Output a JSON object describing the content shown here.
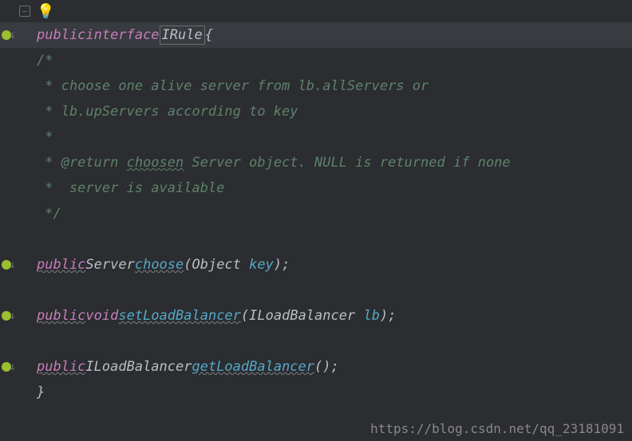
{
  "top": {
    "fold": "−",
    "bulb": "💡"
  },
  "gutter": {
    "marker": "",
    "arrow": "↓"
  },
  "code": {
    "l1": {
      "kw1": "public",
      "kw2": "interface",
      "name": "IRule",
      "brace": "{"
    },
    "c1": "/*",
    "c2": " * choose one alive server from lb.allServers or",
    "c3": " * lb.upServers according to key",
    "c4": " * ",
    "c5a": " * @return ",
    "c5b": "choosen",
    "c5c": " Server object. NULL is returned if none",
    "c6": " *  server is available",
    "c7": " */",
    "m1": {
      "kw": "public",
      "ret": "Server",
      "name": "choose",
      "p1": "(",
      "ptype": "Object ",
      "pname": "key",
      "p2": ");"
    },
    "m2": {
      "kw": "public",
      "ret": "void",
      "name": "setLoadBalancer",
      "p1": "(",
      "ptype": "ILoadBalancer ",
      "pname": "lb",
      "p2": ");"
    },
    "m3": {
      "kw": "public",
      "ret": "ILoadBalancer",
      "name": "getLoadBalancer",
      "p1": "(",
      "p2": ");"
    },
    "close": "}"
  },
  "watermark": "https://blog.csdn.net/qq_23181091"
}
